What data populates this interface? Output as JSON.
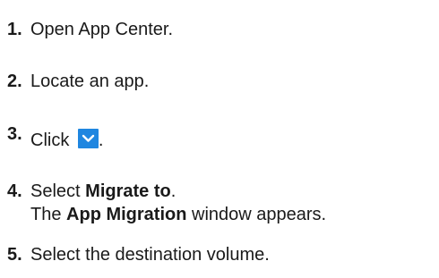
{
  "steps": [
    {
      "num": "1.",
      "text": "Open App Center."
    },
    {
      "num": "2.",
      "text": "Locate an app."
    },
    {
      "num": "3.",
      "pre": "Click ",
      "post": ".",
      "icon": "chevron-down-icon"
    },
    {
      "num": "4.",
      "pre": "Select ",
      "bold": "Migrate to",
      "post": ".",
      "sub": {
        "pre": "The ",
        "bold": "App Migration",
        "post": " window appears."
      }
    },
    {
      "num": "5.",
      "text": "Select the destination volume."
    }
  ],
  "colors": {
    "icon_bg": "#1f86e0",
    "icon_fg": "#ffffff"
  }
}
